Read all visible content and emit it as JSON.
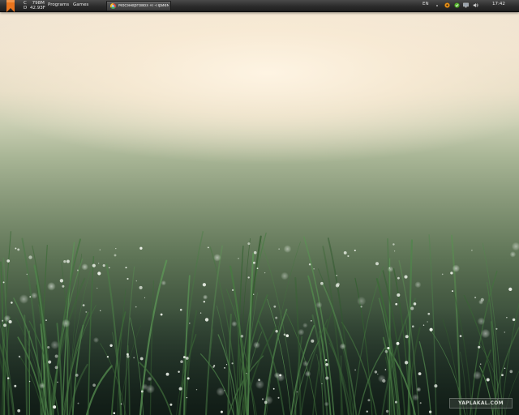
{
  "taskbar": {
    "drives": [
      {
        "letter": "C",
        "free": "798M"
      },
      {
        "letter": "D",
        "free": "42.93F"
      }
    ],
    "menu": {
      "programs": "Programs",
      "games": "Games"
    },
    "active_window": {
      "title": "Мосэнерговоз «I -Прием...",
      "icon": "chrome-icon"
    },
    "tray": {
      "language": "EN",
      "icons": [
        "orange-circle-icon",
        "green-circle-icon",
        "monitor-icon",
        "network-icon",
        "volume-icon"
      ],
      "clock": "17:42"
    },
    "colors": {
      "bookmark": "#e8741e",
      "panel": "#2c2c2c"
    }
  },
  "desktop": {
    "wallpaper": "dewy-grass-wallpaper",
    "watermark": "YAPLAKAL.COM"
  }
}
